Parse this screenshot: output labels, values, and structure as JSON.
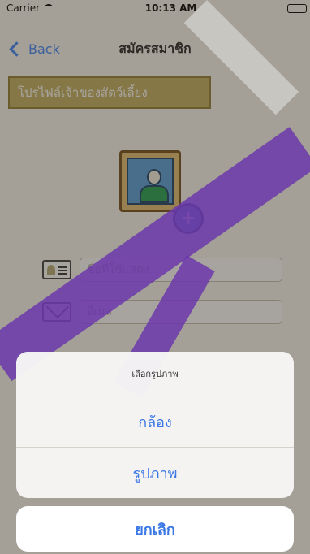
{
  "status_bar": {
    "carrier": "Carrier",
    "time": "10:13 AM"
  },
  "nav": {
    "back_label": "Back",
    "title": "สมัครสมาชิก"
  },
  "section": {
    "title": "โปรไฟล์เจ้าของสัตว์เลี้ยง"
  },
  "form": {
    "display_name_placeholder": "ชื่อที่ใช้แสดง",
    "email_placeholder": "อีเมล"
  },
  "action_sheet": {
    "title": "เลือกรูปภาพ",
    "camera_label": "กล้อง",
    "photos_label": "รูปภาพ",
    "cancel_label": "ยกเลิก"
  },
  "colors": {
    "accent": "#3a77e6",
    "header_gold": "#c9b66a",
    "stripe_purple": "#6c38aa"
  }
}
